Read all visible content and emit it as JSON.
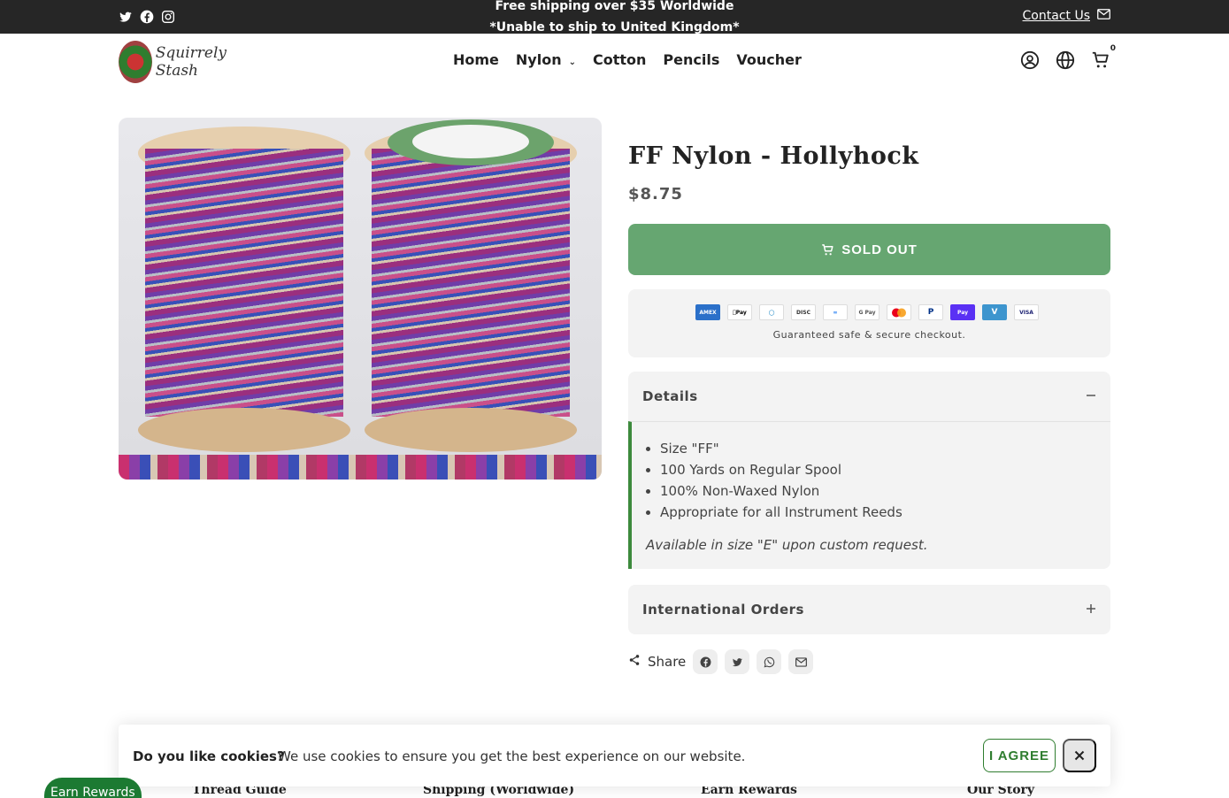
{
  "announcement": {
    "line1": "Free shipping over $35 Worldwide",
    "line2": "*Unable to ship to United Kingdom*",
    "contact_label": "Contact Us"
  },
  "social_icons": [
    "twitter-icon",
    "facebook-icon",
    "instagram-icon"
  ],
  "logo": {
    "line1": "Squirrely",
    "line2": "Stash"
  },
  "nav": {
    "home": "Home",
    "nylon": "Nylon",
    "cotton": "Cotton",
    "pencils": "Pencils",
    "voucher": "Voucher"
  },
  "cart": {
    "count": "0"
  },
  "product": {
    "title": "FF Nylon - Hollyhock",
    "price": "$8.75",
    "sold_out_label": "SOLD OUT"
  },
  "payments": {
    "methods": [
      "AMEX",
      "Apple Pay",
      "Diners",
      "Discover",
      "Meta",
      "G Pay",
      "Mastercard",
      "PayPal",
      "Shop Pay",
      "Venmo",
      "VISA"
    ],
    "note": "Guaranteed safe & secure checkout."
  },
  "details": {
    "heading": "Details",
    "items": [
      "Size \"FF\"",
      "100 Yards on Regular Spool",
      "100% Non-Waxed Nylon",
      "Appropriate for all Instrument Reeds"
    ],
    "note": "Available in size \"E\" upon custom request."
  },
  "international": {
    "heading": "International Orders"
  },
  "share": {
    "label": "Share"
  },
  "cookie": {
    "question": "Do you like cookies?",
    "text": "We use cookies to ensure you get the best experience on our website.",
    "agree_label": "I AGREE"
  },
  "footer": {
    "col1": "Thread Guide",
    "col2": "Shipping (Worldwide)",
    "col3": "Earn Rewards",
    "col4": "Our Story"
  },
  "rewards_button": "Earn Rewards",
  "colors": {
    "topbar": "#262626",
    "soldout": "#66a671",
    "accent_green": "#2f7d2f",
    "rewards": "#1c7a32"
  }
}
